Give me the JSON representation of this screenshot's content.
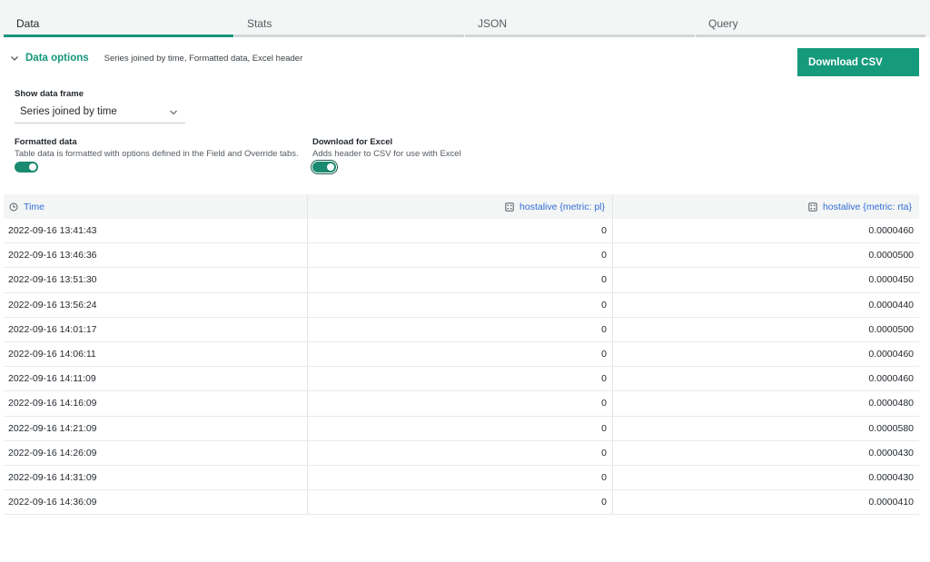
{
  "tabs": [
    {
      "label": "Data",
      "active": true
    },
    {
      "label": "Stats",
      "active": false
    },
    {
      "label": "JSON",
      "active": false
    },
    {
      "label": "Query",
      "active": false
    }
  ],
  "options": {
    "title": "Data options",
    "summary": "Series joined by time, Formatted data, Excel header",
    "download_label": "Download CSV"
  },
  "data_frame": {
    "label": "Show data frame",
    "selected": "Series joined by time"
  },
  "formatted": {
    "label": "Formatted data",
    "description": "Table data is formatted with options defined in the Field and Override tabs.",
    "enabled": true
  },
  "excel": {
    "label": "Download for Excel",
    "description": "Adds header to CSV for use with Excel",
    "enabled": true
  },
  "accent_color": "#159a7c",
  "link_color": "#2f6fd6",
  "table": {
    "columns": [
      "Time",
      "hostalive {metric: pl}",
      "hostalive {metric: rta}"
    ],
    "rows": [
      [
        "2022-09-16 13:41:43",
        "0",
        "0.0000460"
      ],
      [
        "2022-09-16 13:46:36",
        "0",
        "0.0000500"
      ],
      [
        "2022-09-16 13:51:30",
        "0",
        "0.0000450"
      ],
      [
        "2022-09-16 13:56:24",
        "0",
        "0.0000440"
      ],
      [
        "2022-09-16 14:01:17",
        "0",
        "0.0000500"
      ],
      [
        "2022-09-16 14:06:11",
        "0",
        "0.0000460"
      ],
      [
        "2022-09-16 14:11:09",
        "0",
        "0.0000460"
      ],
      [
        "2022-09-16 14:16:09",
        "0",
        "0.0000480"
      ],
      [
        "2022-09-16 14:21:09",
        "0",
        "0.0000580"
      ],
      [
        "2022-09-16 14:26:09",
        "0",
        "0.0000430"
      ],
      [
        "2022-09-16 14:31:09",
        "0",
        "0.0000430"
      ],
      [
        "2022-09-16 14:36:09",
        "0",
        "0.0000410"
      ]
    ]
  }
}
